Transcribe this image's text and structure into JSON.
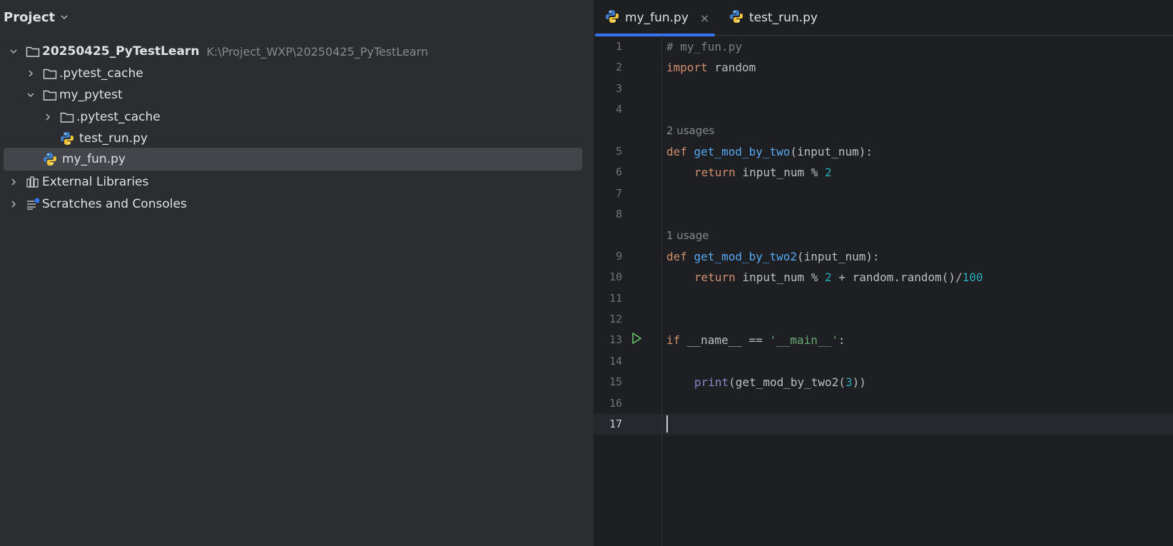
{
  "project_panel": {
    "title": "Project",
    "tree": [
      {
        "label": "20250425_PyTestLearn",
        "path": "K:\\Project_WXP\\20250425_PyTestLearn"
      },
      {
        "label": ".pytest_cache"
      },
      {
        "label": "my_pytest"
      },
      {
        "label": ".pytest_cache"
      },
      {
        "label": "test_run.py"
      },
      {
        "label": "my_fun.py"
      },
      {
        "label": "External Libraries"
      },
      {
        "label": "Scratches and Consoles"
      }
    ]
  },
  "editor": {
    "tabs": [
      {
        "label": "my_fun.py",
        "close": "×"
      },
      {
        "label": "test_run.py"
      }
    ],
    "line_numbers": [
      "1",
      "2",
      "3",
      "4",
      "5",
      "6",
      "7",
      "8",
      "9",
      "10",
      "11",
      "12",
      "13",
      "14",
      "15",
      "16",
      "17"
    ],
    "usage_hints": [
      "2 usages",
      "1 usage"
    ],
    "code": {
      "l1": "# my_fun.py",
      "l2_kw": "import",
      "l2_rest": " random",
      "l5_kw": "def ",
      "l5_fn": "get_mod_by_two",
      "l5_rest": "(input_num):",
      "l6_kw": "return",
      "l6_rest": " input_num % ",
      "l6_num": "2",
      "l9_kw": "def ",
      "l9_fn": "get_mod_by_two2",
      "l9_rest": "(input_num):",
      "l10_kw": "return",
      "l10_rest": " input_num % ",
      "l10_num": "2",
      "l10_rest2": " + random.random()/",
      "l10_num2": "100",
      "l13_kw": "if",
      "l13_rest": " __name__ == ",
      "l13_str": "'__main__'",
      "l13_end": ":",
      "l15_bi": "print",
      "l15_rest": "(get_mod_by_two2(",
      "l15_num": "3",
      "l15_end": "))"
    }
  }
}
